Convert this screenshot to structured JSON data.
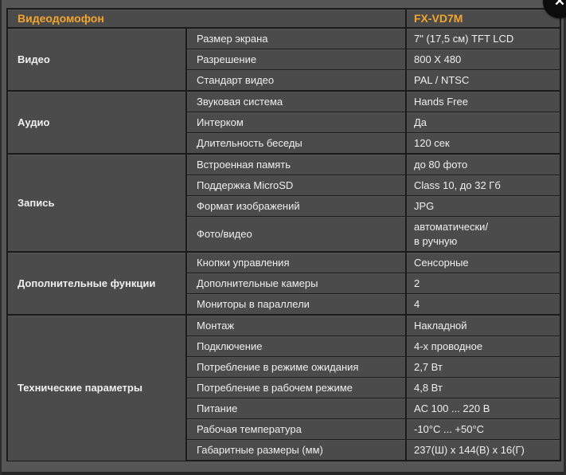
{
  "colors": {
    "accent": "#f2a52d",
    "page_bg": "#565656",
    "cell_bg": "#4b4b4b",
    "border": "#1a1a1a",
    "text": "#efefef",
    "close_bg": "#0c0c0c"
  },
  "icons": {
    "close": "✕"
  },
  "header": {
    "title": "Видеодомофон",
    "model": "FX-VD7M"
  },
  "sections": [
    {
      "category": "Видео",
      "rows": [
        {
          "param": "Размер экрана",
          "value": "7\" (17,5 см) TFT LCD"
        },
        {
          "param": "Разрешение",
          "value": "800 X 480"
        },
        {
          "param": "Стандарт видео",
          "value": "PAL / NTSC"
        }
      ]
    },
    {
      "category": "Аудио",
      "rows": [
        {
          "param": "Звуковая система",
          "value": "Hands Free"
        },
        {
          "param": "Интерком",
          "value": "Да"
        },
        {
          "param": "Длительность беседы",
          "value": "120 сек"
        }
      ]
    },
    {
      "category": "Запись",
      "rows": [
        {
          "param": "Встроенная память",
          "value": "до 80 фото"
        },
        {
          "param": "Поддержка MicroSD",
          "value": "Class 10, до 32 Гб"
        },
        {
          "param": "Формат изображений",
          "value": "JPG"
        },
        {
          "param": "Фото/видео",
          "value": "автоматически/\nв ручную",
          "tall": true
        }
      ]
    },
    {
      "category": "Дополнительные функции",
      "rows": [
        {
          "param": "Кнопки управления",
          "value": "Сенсорные"
        },
        {
          "param": "Дополнительные камеры",
          "value": "2"
        },
        {
          "param": "Мониторы в параллели",
          "value": "4"
        }
      ]
    },
    {
      "category": "Технические параметры",
      "rows": [
        {
          "param": "Монтаж",
          "value": "Накладной"
        },
        {
          "param": "Подключение",
          "value": "4-х проводное"
        },
        {
          "param": "Потребление в режиме ожидания",
          "value": "2,7 Вт"
        },
        {
          "param": "Потребление в рабочем режиме",
          "value": "4,8 Вт"
        },
        {
          "param": "Питание",
          "value": "AC 100 ... 220 В"
        },
        {
          "param": "Рабочая температура",
          "value": "-10°C ... +50°C"
        },
        {
          "param": "Габаритные размеры (мм)",
          "value": "237(Ш) x 144(В) x 16(Г)"
        }
      ]
    }
  ]
}
